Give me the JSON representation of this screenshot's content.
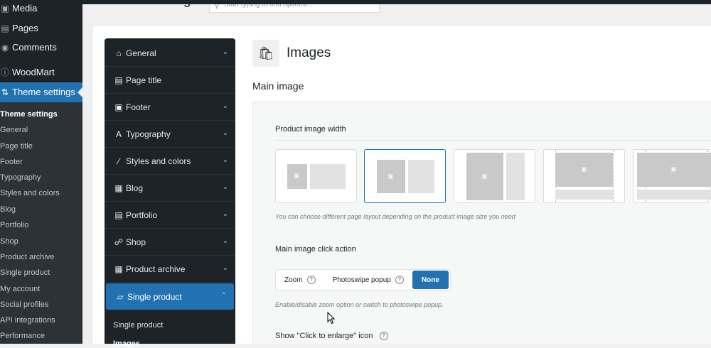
{
  "wp_menu": {
    "items": [
      {
        "label": "Media",
        "icon": "media-icon"
      },
      {
        "label": "Pages",
        "icon": "pages-icon"
      },
      {
        "label": "Comments",
        "icon": "comments-icon"
      },
      {
        "label": "WoodMart",
        "icon": "woodmart-icon"
      },
      {
        "label": "Theme settings",
        "icon": "sliders-icon"
      }
    ],
    "submenu": [
      "Theme settings",
      "General",
      "Page title",
      "Footer",
      "Typography",
      "Styles and colors",
      "Blog",
      "Portfolio",
      "Shop",
      "Product archive",
      "Single product",
      "My account",
      "Social profiles",
      "API integrations",
      "Performance"
    ]
  },
  "header": {
    "title": "Theme settings",
    "search_placeholder": "Start typing to find options..."
  },
  "theme_nav": {
    "items": [
      {
        "label": "General",
        "icon": "home-icon"
      },
      {
        "label": "Page title",
        "icon": "page-title-icon"
      },
      {
        "label": "Footer",
        "icon": "footer-icon"
      },
      {
        "label": "Typography",
        "icon": "typography-icon"
      },
      {
        "label": "Styles and colors",
        "icon": "brush-icon"
      },
      {
        "label": "Blog",
        "icon": "blog-icon"
      },
      {
        "label": "Portfolio",
        "icon": "portfolio-icon"
      },
      {
        "label": "Shop",
        "icon": "cart-icon"
      },
      {
        "label": "Product archive",
        "icon": "archive-icon"
      },
      {
        "label": "Single product",
        "icon": "bag-icon"
      }
    ],
    "sub_items": [
      "Single product",
      "Images"
    ]
  },
  "main": {
    "title": "Images",
    "section_title": "Main image",
    "product_image_width": {
      "label": "Product image width",
      "selected_index": 1,
      "hint": "You can choose different page layout depending on the product image size you need"
    },
    "click_action": {
      "label": "Main image click action",
      "options": [
        "Zoom",
        "Photoswipe popup",
        "None"
      ],
      "selected": "None",
      "hint": "Enable/disable zoom option or switch to photoswipe popup."
    },
    "enlarge_label": "Show \"Click to enlarge\" icon"
  },
  "colors": {
    "accent": "#2271b1",
    "sidebar_bg": "#1d2327"
  }
}
